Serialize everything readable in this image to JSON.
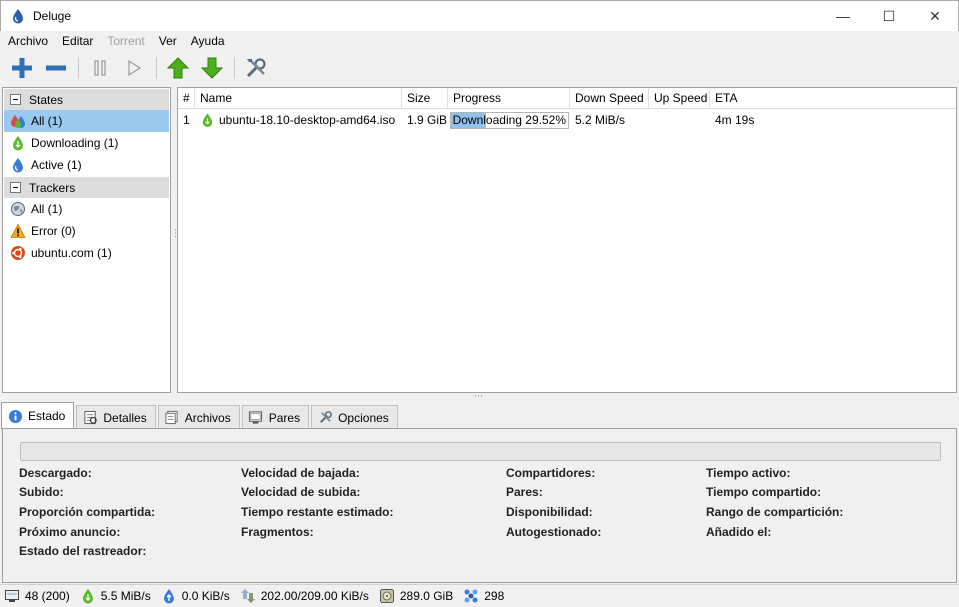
{
  "window": {
    "title": "Deluge",
    "minimize": "—",
    "maximize": "☐",
    "close": "✕"
  },
  "menu": [
    "Archivo",
    "Editar",
    "Torrent",
    "Ver",
    "Ayuda"
  ],
  "sidebar": {
    "states_header": "States",
    "states": [
      {
        "label": "All (1)",
        "icon": "all-torrents-icon",
        "selected": true
      },
      {
        "label": "Downloading (1)",
        "icon": "downloading-icon"
      },
      {
        "label": "Active (1)",
        "icon": "active-icon"
      }
    ],
    "trackers_header": "Trackers",
    "trackers": [
      {
        "label": "All (1)",
        "icon": "globe-icon"
      },
      {
        "label": "Error (0)",
        "icon": "warning-icon"
      },
      {
        "label": "ubuntu.com (1)",
        "icon": "ubuntu-icon"
      }
    ]
  },
  "torrent_list": {
    "columns": [
      "#",
      "Name",
      "Size",
      "Progress",
      "Down Speed",
      "Up Speed",
      "ETA"
    ],
    "rows": [
      {
        "num": "1",
        "name": "ubuntu-18.10-desktop-amd64.iso",
        "size": "1.9 GiB",
        "progress_text": "Downloading 29.52%",
        "progress": 0.2952,
        "down_speed": "5.2 MiB/s",
        "up_speed": "",
        "eta": "4m 19s"
      }
    ]
  },
  "tabs": [
    {
      "label": "Estado",
      "icon": "info-icon",
      "active": true
    },
    {
      "label": "Detalles",
      "icon": "details-icon"
    },
    {
      "label": "Archivos",
      "icon": "files-icon"
    },
    {
      "label": "Pares",
      "icon": "peers-icon"
    },
    {
      "label": "Opciones",
      "icon": "options-icon"
    }
  ],
  "details": {
    "col1": [
      "Descargado:",
      "Subido:",
      "Proporción compartida:",
      "Próximo anuncio:",
      "Estado del rastreador:"
    ],
    "col2": [
      "Velocidad de bajada:",
      "Velocidad de subida:",
      "Tiempo restante estimado:",
      "Fragmentos:"
    ],
    "col3": [
      "Compartidores:",
      "Pares:",
      "Disponibilidad:",
      "Autogestionado:"
    ],
    "col4": [
      "Tiempo activo:",
      "Tiempo compartido:",
      "Rango de compartición:",
      "Añadido el:"
    ]
  },
  "statusbar": {
    "connections": "48 (200)",
    "download": "5.5 MiB/s",
    "upload": "0.0 KiB/s",
    "protocol": "202.00/209.00 KiB/s",
    "free_space": "289.0 GiB",
    "dht_nodes": "298"
  },
  "colors": {
    "selection": "#99c9ef",
    "progress": "#8fc1ec",
    "green_arrow": "#4caf1e"
  }
}
